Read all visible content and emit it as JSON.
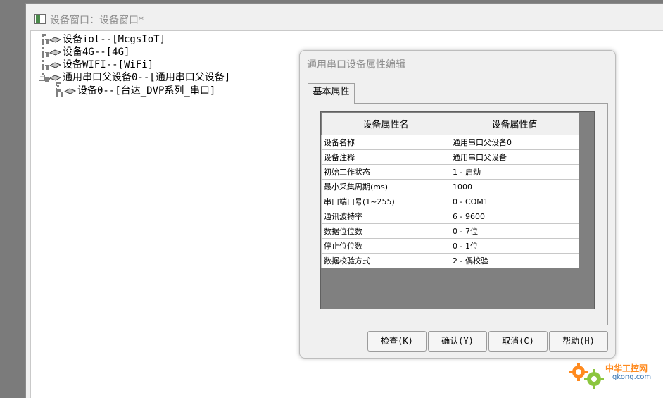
{
  "main_window": {
    "title": "设备窗口：设备窗口*"
  },
  "tree": {
    "nodes": [
      {
        "label": "设备iot--[McgsIoT]"
      },
      {
        "label": "设备4G--[4G]"
      },
      {
        "label": "设备WIFI--[WiFi]"
      },
      {
        "label": "通用串口父设备0--[通用串口父设备]",
        "expander": "-"
      },
      {
        "label": "设备0--[台达_DVP系列_串口]"
      }
    ]
  },
  "dialog": {
    "title": "通用串口设备属性编辑",
    "tab": "基本属性",
    "columns": [
      "设备属性名",
      "设备属性值"
    ],
    "rows": [
      [
        "设备名称",
        "通用串口父设备0"
      ],
      [
        "设备注释",
        "通用串口父设备"
      ],
      [
        "初始工作状态",
        "1 - 启动"
      ],
      [
        "最小采集周期(ms)",
        "1000"
      ],
      [
        "串口端口号(1~255)",
        "0 - COM1"
      ],
      [
        "通讯波特率",
        "6 - 9600"
      ],
      [
        "数据位位数",
        "0 - 7位"
      ],
      [
        "停止位位数",
        "0 - 1位"
      ],
      [
        "数据校验方式",
        "2 - 偶校验"
      ]
    ],
    "buttons": {
      "check": "检查(K)",
      "confirm": "确认(Y)",
      "cancel": "取消(C)",
      "help": "帮助(H)"
    }
  },
  "watermark": {
    "line1": "中华工控网",
    "line2": "gkong.com"
  },
  "colors": {
    "grid_bg": "#808080",
    "desktop": "#7b7b7b",
    "watermark_orange": "#ff8a1e",
    "watermark_blue": "#2e6fb0"
  }
}
